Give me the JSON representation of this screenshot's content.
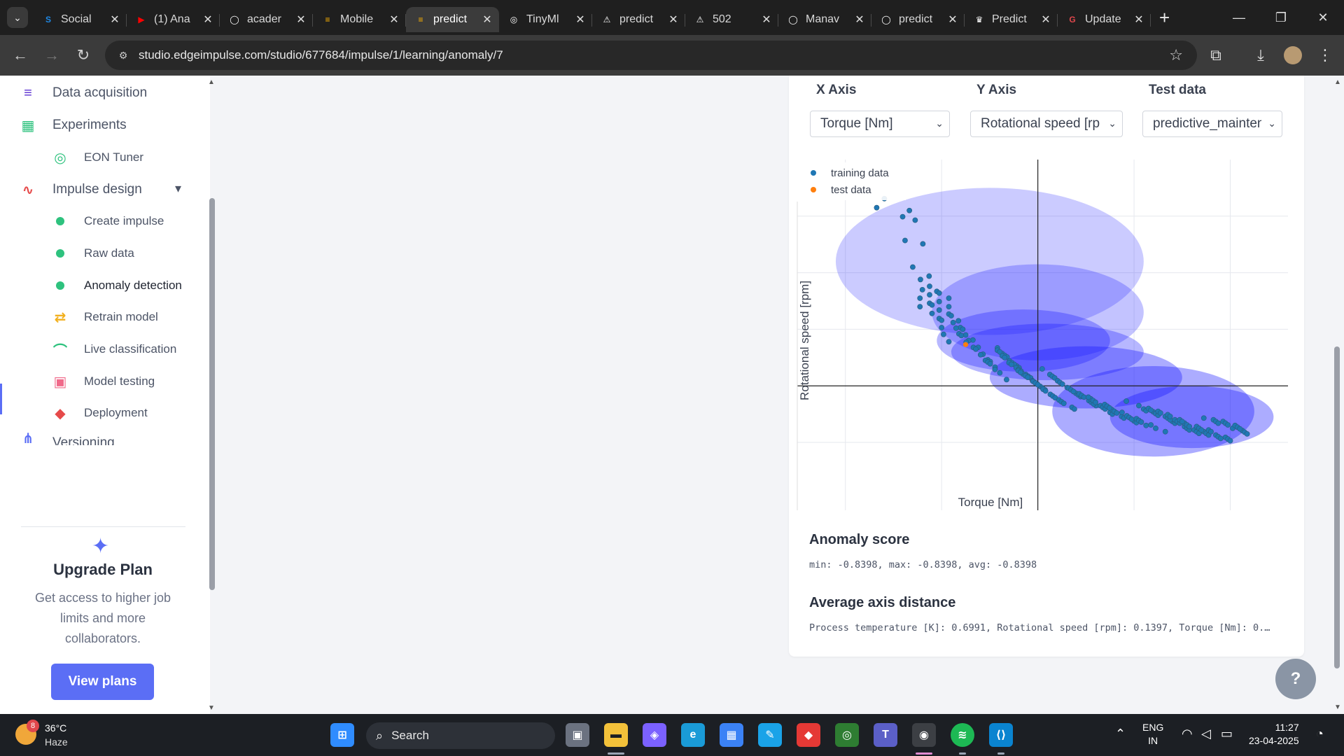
{
  "browser": {
    "tabs": [
      {
        "label": "Social",
        "favicon": "S",
        "color": "#1e88e5"
      },
      {
        "label": "(1) Ana",
        "favicon": "▶",
        "color": "#ff0000"
      },
      {
        "label": "acader",
        "favicon": "◯",
        "color": "#ffffff"
      },
      {
        "label": "Mobile",
        "favicon": "≡",
        "color": "#ffb300"
      },
      {
        "label": "predict",
        "favicon": "≡",
        "color": "#ffb300",
        "active": true
      },
      {
        "label": "TinyMl",
        "favicon": "◎",
        "color": "#ffffff"
      },
      {
        "label": "predict",
        "favicon": "⚠",
        "color": "#ffffff"
      },
      {
        "label": "502",
        "favicon": "⚠",
        "color": "#ffffff"
      },
      {
        "label": "Manav",
        "favicon": "◯",
        "color": "#ffffff"
      },
      {
        "label": "predict",
        "favicon": "◯",
        "color": "#ffffff"
      },
      {
        "label": "Predict",
        "favicon": "♛",
        "color": "#ffffff"
      },
      {
        "label": "Update",
        "favicon": "G",
        "color": "#e0474c"
      }
    ],
    "url": "studio.edgeimpulse.com/studio/677684/impulse/1/learning/anomaly/7"
  },
  "sidebar": {
    "items": [
      {
        "label": "Data acquisition",
        "icon": "database-icon"
      },
      {
        "label": "Experiments",
        "icon": "table-icon"
      },
      {
        "label": "EON Tuner",
        "icon": "compass-icon"
      },
      {
        "label": "Impulse design",
        "icon": "pulse-icon"
      },
      {
        "label": "Create impulse",
        "icon": "status-dot-icon"
      },
      {
        "label": "Raw data",
        "icon": "status-dot-icon"
      },
      {
        "label": "Anomaly detection",
        "icon": "status-dot-icon"
      },
      {
        "label": "Retrain model",
        "icon": "shuffle-icon"
      },
      {
        "label": "Live classification",
        "icon": "live-icon"
      },
      {
        "label": "Model testing",
        "icon": "clipboard-icon"
      },
      {
        "label": "Deployment",
        "icon": "cube-icon"
      },
      {
        "label": "Versioning",
        "icon": "versioning-icon"
      }
    ],
    "upgrade": {
      "title": "Upgrade Plan",
      "text": "Get access to higher job limits and more collaborators.",
      "button": "View plans"
    }
  },
  "explorer": {
    "x_axis_label": "X Axis",
    "y_axis_label": "Y Axis",
    "test_data_label": "Test data",
    "x_select": "Torque [Nm]",
    "y_select": "Rotational speed [rpm]",
    "test_select": "predictive_maintenance"
  },
  "chart_data": {
    "type": "scatter",
    "xlabel": "Torque [Nm]",
    "ylabel": "Rotational speed [rpm]",
    "legend": [
      {
        "name": "training data",
        "color": "#1f77b4"
      },
      {
        "name": "test data",
        "color": "#ff7f0e"
      }
    ],
    "legend_position": "top-left",
    "grid": true,
    "xlim": [
      -2.5,
      2.6
    ],
    "ylim": [
      -2.2,
      4.0
    ],
    "note": "Axis lines drawn at zero; tick labels not shown in the screenshot.",
    "clusters": [
      {
        "cx": -0.5,
        "cy": 2.2,
        "rx": 1.6,
        "ry": 1.3,
        "opacity": 0.22
      },
      {
        "cx": 0.0,
        "cy": 1.3,
        "rx": 1.1,
        "ry": 0.85,
        "opacity": 0.25
      },
      {
        "cx": -0.15,
        "cy": 0.8,
        "rx": 0.9,
        "ry": 0.55,
        "opacity": 0.3
      },
      {
        "cx": 0.1,
        "cy": 0.6,
        "rx": 1.0,
        "ry": 0.5,
        "opacity": 0.3
      },
      {
        "cx": 0.5,
        "cy": 0.15,
        "rx": 1.0,
        "ry": 0.55,
        "opacity": 0.35
      },
      {
        "cx": 1.2,
        "cy": -0.45,
        "rx": 1.05,
        "ry": 0.8,
        "opacity": 0.35
      },
      {
        "cx": 1.6,
        "cy": -0.55,
        "rx": 0.85,
        "ry": 0.55,
        "opacity": 0.35
      }
    ],
    "training_points": [
      [
        -1.55,
        3.3
      ],
      [
        -1.52,
        3.25
      ],
      [
        -1.38,
        3.05
      ],
      [
        -1.36,
        2.95
      ],
      [
        -1.35,
        2.9
      ],
      [
        -1.32,
        2.6
      ],
      [
        -1.28,
        2.45
      ],
      [
        -1.25,
        2.1
      ],
      [
        -1.22,
        2.0
      ],
      [
        -1.18,
        1.85
      ],
      [
        -1.15,
        1.7
      ],
      [
        -1.1,
        1.55
      ],
      [
        -1.05,
        1.4
      ],
      [
        -1.0,
        1.25
      ],
      [
        -0.95,
        1.12
      ],
      [
        -0.88,
        1.0
      ],
      [
        -0.8,
        0.9
      ],
      [
        -0.72,
        0.8
      ],
      [
        -0.62,
        0.68
      ],
      [
        -0.52,
        0.58
      ],
      [
        -0.42,
        0.48
      ],
      [
        -0.32,
        0.38
      ],
      [
        -0.2,
        0.26
      ],
      [
        -0.08,
        0.15
      ],
      [
        0.05,
        0.05
      ],
      [
        0.18,
        -0.06
      ],
      [
        0.32,
        -0.16
      ],
      [
        0.48,
        -0.26
      ],
      [
        0.65,
        -0.35
      ],
      [
        0.82,
        -0.42
      ],
      [
        1.0,
        -0.5
      ],
      [
        1.15,
        -0.55
      ],
      [
        1.3,
        -0.6
      ],
      [
        1.45,
        -0.66
      ],
      [
        1.6,
        -0.72
      ],
      [
        1.75,
        -0.75
      ],
      [
        1.9,
        -0.78
      ],
      [
        2.05,
        -0.82
      ]
    ],
    "test_points": [
      [
        -0.75,
        0.73
      ]
    ]
  },
  "anomaly": {
    "title": "Anomaly score",
    "text": "min: -0.8398, max: -0.8398, avg: -0.8398"
  },
  "axis_distance": {
    "title": "Average axis distance",
    "text": "Process temperature [K]: 0.6991, Rotational speed [rpm]: 0.1397, Torque [Nm]: 0.…"
  },
  "taskbar": {
    "temperature": "36°C",
    "condition": "Haze",
    "weather_badge": "8",
    "search": "Search",
    "lang_top": "ENG",
    "lang_bottom": "IN",
    "time": "11:27",
    "date": "23-04-2025"
  }
}
